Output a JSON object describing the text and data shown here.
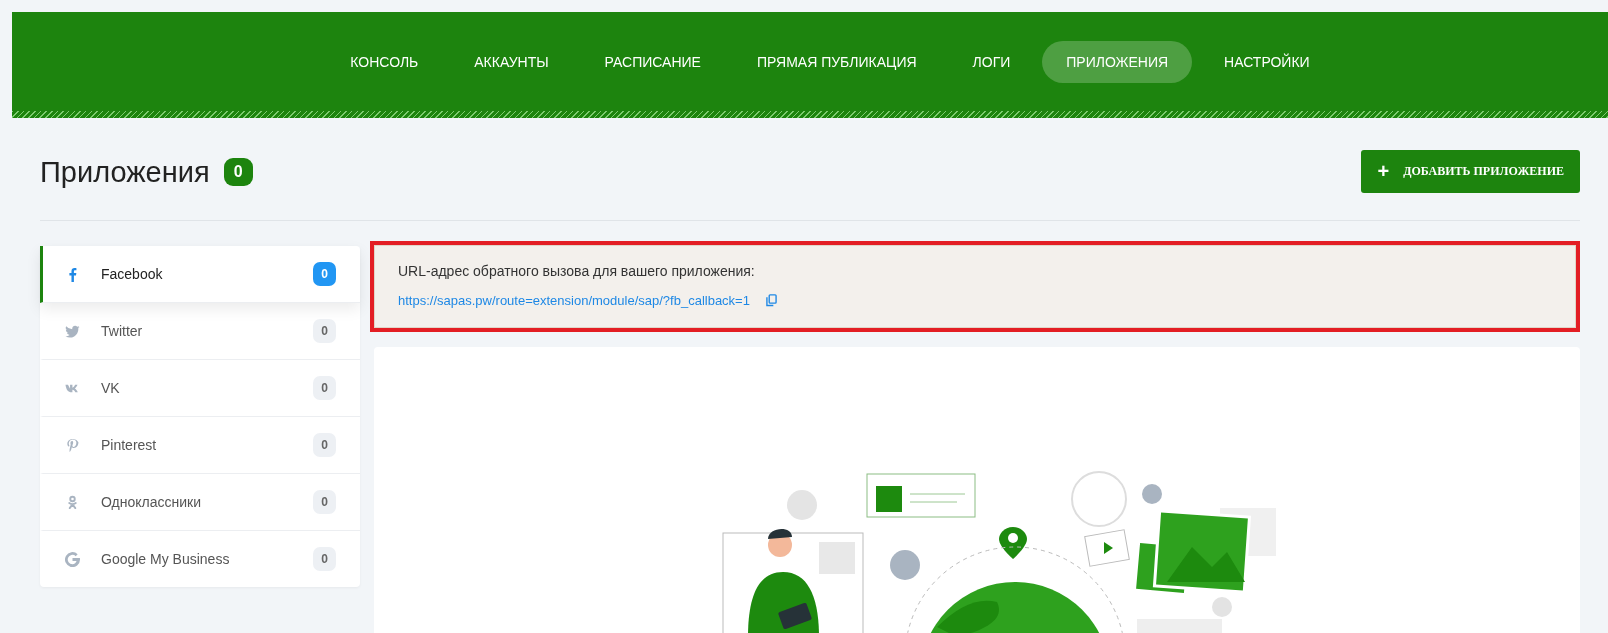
{
  "nav": [
    {
      "label": "КОНСОЛЬ",
      "selected": false
    },
    {
      "label": "АККАУНТЫ",
      "selected": false
    },
    {
      "label": "РАСПИСАНИЕ",
      "selected": false
    },
    {
      "label": "ПРЯМАЯ ПУБЛИКАЦИЯ",
      "selected": false
    },
    {
      "label": "ЛОГИ",
      "selected": false
    },
    {
      "label": "ПРИЛОЖЕНИЯ",
      "selected": true
    },
    {
      "label": "НАСТРОЙКИ",
      "selected": false
    }
  ],
  "page": {
    "title": "Приложения",
    "count": "0",
    "add_button": {
      "icon": "+",
      "label": "ДОБАВИТЬ ПРИЛОЖЕНИЕ"
    }
  },
  "sidebar": {
    "items": [
      {
        "kind": "facebook",
        "label": "Facebook",
        "count": "0",
        "selected": true
      },
      {
        "kind": "twitter",
        "label": "Twitter",
        "count": "0",
        "selected": false
      },
      {
        "kind": "vk",
        "label": "VK",
        "count": "0",
        "selected": false
      },
      {
        "kind": "pinterest",
        "label": "Pinterest",
        "count": "0",
        "selected": false
      },
      {
        "kind": "odnoklassniki",
        "label": "Одноклассники",
        "count": "0",
        "selected": false
      },
      {
        "kind": "google",
        "label": "Google My Business",
        "count": "0",
        "selected": false
      }
    ]
  },
  "notice": {
    "text": "URL-адрес обратного вызова для вашего приложения:",
    "link": "https://sapas.pw/route=extension/module/sap/?fb_callback=1"
  }
}
